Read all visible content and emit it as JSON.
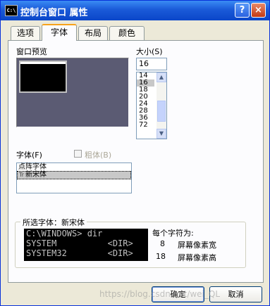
{
  "window": {
    "title": "控制台窗口 属性",
    "icon_text": "C:\\",
    "help_button": "?",
    "close_button": "×"
  },
  "tabs": [
    {
      "label": "选项",
      "active": false
    },
    {
      "label": "字体",
      "active": true
    },
    {
      "label": "布局",
      "active": false
    },
    {
      "label": "颜色",
      "active": false
    }
  ],
  "preview": {
    "label": "窗口预览"
  },
  "size": {
    "label": "大小(S)",
    "value": "16",
    "options": [
      "14",
      "16",
      "18",
      "20",
      "24",
      "28",
      "36",
      "72"
    ],
    "selected": "16",
    "scroll_up": "▲",
    "scroll_down": "▼"
  },
  "font": {
    "label": "字体(F)",
    "bold_label": "粗体(B)",
    "bold_checked": false,
    "items": [
      {
        "name": "点阵字体",
        "tt": "",
        "selected": false
      },
      {
        "name": "新宋体",
        "tt": "Tr",
        "selected": true
      }
    ]
  },
  "selected_font": {
    "group_title": "所选字体：新宋体",
    "console_lines": [
      "C:\\WINDOWS> dir",
      "SYSTEM          <DIR>",
      "SYSTEM32        <DIR>"
    ],
    "char_is_label": "每个字符为:",
    "width_value": "8",
    "width_unit": "屏幕像素宽",
    "height_value": "18",
    "height_unit": "屏幕像素高"
  },
  "buttons": {
    "ok": "确定",
    "cancel": "取消"
  },
  "watermark": "https://blog.csdn.net/wei_QL",
  "colors": {
    "titlebar": "#0a46c9",
    "dialog_bg": "#ece9d8",
    "tab_accent": "#f7a21b",
    "preview_bg": "#5b5b73"
  }
}
